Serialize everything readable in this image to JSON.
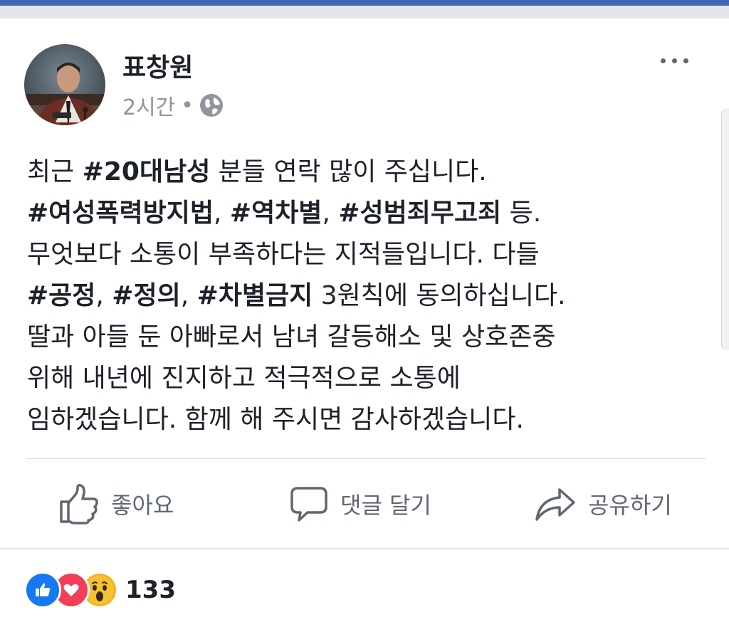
{
  "post": {
    "author": "표창원",
    "time": "2시간",
    "separator": "•",
    "privacy_icon": "globe-icon",
    "more_icon": "more-dots-icon",
    "lines": [
      [
        {
          "t": "최근 ",
          "b": false
        },
        {
          "t": "#20대남성",
          "b": true
        },
        {
          "t": " 분들 연락 많이 주십니다.",
          "b": false
        }
      ],
      [
        {
          "t": "#여성폭력방지법",
          "b": true
        },
        {
          "t": ", ",
          "b": false
        },
        {
          "t": "#역차별",
          "b": true
        },
        {
          "t": ", ",
          "b": false
        },
        {
          "t": "#성범죄무고죄",
          "b": true
        },
        {
          "t": " 등.",
          "b": false
        }
      ],
      [
        {
          "t": "무엇보다 소통이 부족하다는 지적들입니다. 다들",
          "b": false
        }
      ],
      [
        {
          "t": "#공정",
          "b": true
        },
        {
          "t": ", ",
          "b": false
        },
        {
          "t": "#정의",
          "b": true
        },
        {
          "t": ", ",
          "b": false
        },
        {
          "t": "#차별금지",
          "b": true
        },
        {
          "t": " 3원칙에 동의하십니다.",
          "b": false
        }
      ],
      [
        {
          "t": "딸과 아들 둔 아빠로서 남녀 갈등해소 및 상호존중",
          "b": false
        }
      ],
      [
        {
          "t": "위해 내년에 진지하고 적극적으로 소통에",
          "b": false
        }
      ],
      [
        {
          "t": "임하겠습니다. 함께 해 주시면 감사하겠습니다.",
          "b": false
        }
      ]
    ]
  },
  "actions": {
    "like": {
      "label": "좋아요",
      "icon": "thumbs-up-icon"
    },
    "comment": {
      "label": "댓글 달기",
      "icon": "comment-bubble-icon"
    },
    "share": {
      "label": "공유하기",
      "icon": "share-arrow-icon"
    }
  },
  "reactions": {
    "types": [
      "like",
      "love",
      "wow"
    ],
    "count": "133"
  },
  "colors": {
    "brand_bar": "#4267b2",
    "like_blue": "#1877f2",
    "love_red": "#f33e58",
    "wow_yellow": "#f7b125",
    "muted_text": "#606770"
  }
}
